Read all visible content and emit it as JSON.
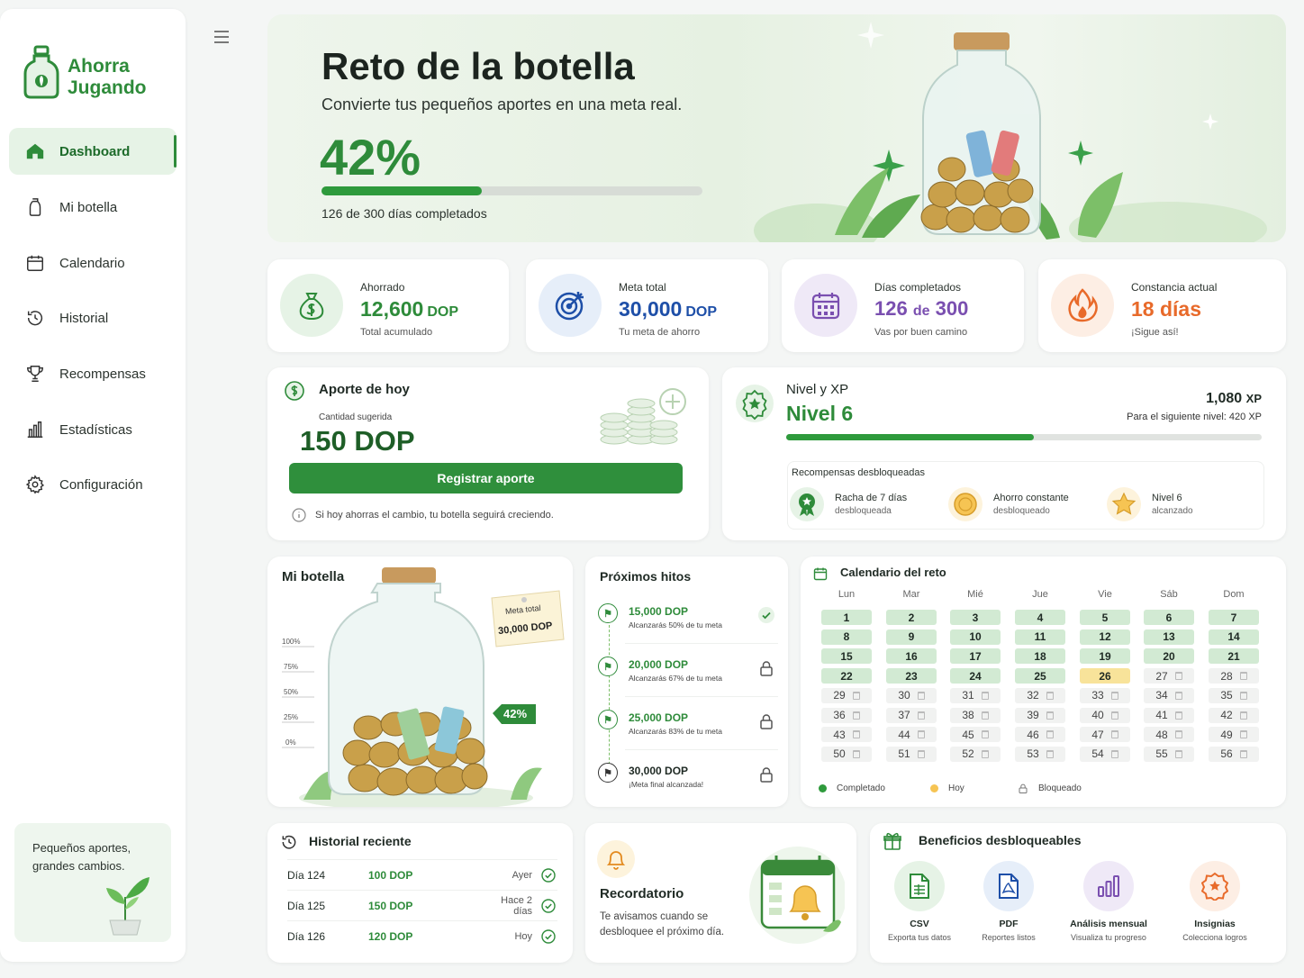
{
  "brand": {
    "line1": "Ahorra",
    "line2": "Jugando"
  },
  "nav": [
    {
      "label": "Dashboard",
      "icon": "home-icon"
    },
    {
      "label": "Mi botella",
      "icon": "bottle-icon"
    },
    {
      "label": "Calendario",
      "icon": "calendar-icon"
    },
    {
      "label": "Historial",
      "icon": "history-icon"
    },
    {
      "label": "Recompensas",
      "icon": "trophy-icon"
    },
    {
      "label": "Estadísticas",
      "icon": "stats-icon"
    },
    {
      "label": "Configuración",
      "icon": "gear-icon"
    }
  ],
  "sidebar_tip": "Pequeños aportes, grandes cambios.",
  "hero": {
    "title": "Reto de la botella",
    "subtitle": "Convierte tus pequeños aportes en una meta real.",
    "percent": "42%",
    "progress": 0.42,
    "days": "126 de 300 días completados"
  },
  "stats": [
    {
      "label": "Ahorrado",
      "value": "12,600",
      "unit": "DOP",
      "sub": "Total acumulado",
      "icon": "money-bag-icon"
    },
    {
      "label": "Meta total",
      "value": "30,000",
      "unit": "DOP",
      "sub": "Tu meta de ahorro",
      "icon": "target-icon"
    },
    {
      "label": "Días completados",
      "value": "126",
      "mid": "de",
      "value2": "300",
      "sub": "Vas por buen camino",
      "icon": "calendar-grid-icon"
    },
    {
      "label": "Constancia actual",
      "value": "18 días",
      "sub": "¡Sigue así!",
      "icon": "flame-icon"
    }
  ],
  "aporte": {
    "title": "Aporte de hoy",
    "label": "Cantidad sugerida",
    "amount": "150",
    "unit": "DOP",
    "button": "Registrar aporte",
    "hint": "Si hoy ahorras el cambio, tu botella seguirá creciendo."
  },
  "nivel": {
    "title": "Nivel y XP",
    "level": "Nivel 6",
    "xp": "1,080",
    "xp_unit": "XP",
    "next": "Para el siguiente nivel: 420 XP",
    "progress": 0.52,
    "rewards_title": "Recompensas desbloqueadas",
    "rewards": [
      {
        "title": "Racha de 7 días",
        "sub": "desbloqueada"
      },
      {
        "title": "Ahorro constante",
        "sub": "desbloqueado"
      },
      {
        "title": "Nivel 6",
        "sub": "alcanzado"
      }
    ]
  },
  "bottle": {
    "title": "Mi botella",
    "scale": [
      "100%",
      "75%",
      "50%",
      "25%",
      "0%"
    ],
    "note_line1": "Meta total",
    "note_line2": "30,000 DOP",
    "fill_label": "42%"
  },
  "hitos": {
    "title": "Próximos hitos",
    "items": [
      {
        "value": "15,000 DOP",
        "sub": "Alcanzarás 50% de tu meta",
        "state": "done"
      },
      {
        "value": "20,000 DOP",
        "sub": "Alcanzarás 67% de tu meta",
        "state": "locked"
      },
      {
        "value": "25,000 DOP",
        "sub": "Alcanzarás 83% de tu meta",
        "state": "locked"
      },
      {
        "value": "30,000 DOP",
        "sub": "¡Meta final alcanzada!",
        "state": "locked"
      }
    ]
  },
  "calendar": {
    "title": "Calendario del reto",
    "days_of_week": [
      "Lun",
      "Mar",
      "Mié",
      "Jue",
      "Vie",
      "Sáb",
      "Dom"
    ],
    "completed_through": 25,
    "today": 26,
    "last_day": 56,
    "legend": [
      "Completado",
      "Hoy",
      "Bloqueado"
    ]
  },
  "historial": {
    "title": "Historial reciente",
    "rows": [
      {
        "day": "Día 124",
        "amount": "100 DOP",
        "when": "Ayer"
      },
      {
        "day": "Día 125",
        "amount": "150 DOP",
        "when": "Hace 2 días"
      },
      {
        "day": "Día 126",
        "amount": "120 DOP",
        "when": "Hoy"
      }
    ]
  },
  "recordatorio": {
    "title": "Recordatorio",
    "text": "Te avisamos cuando se desbloquee el próximo día."
  },
  "beneficios": {
    "title": "Beneficios desbloqueables",
    "items": [
      {
        "title": "CSV",
        "sub": "Exporta tus datos",
        "icon": "csv-file-icon"
      },
      {
        "title": "PDF",
        "sub": "Reportes listos",
        "icon": "pdf-file-icon"
      },
      {
        "title": "Análisis mensual",
        "sub": "Visualiza tu progreso",
        "icon": "chart-icon"
      },
      {
        "title": "Insignias",
        "sub": "Colecciona logros",
        "icon": "badge-icon"
      }
    ]
  },
  "colors": {
    "primary": "#2e8b3a",
    "accent_orange": "#e86a2a",
    "accent_blue": "#1e4fa8",
    "accent_purple": "#7a4fb0",
    "today": "#f8e39a"
  }
}
